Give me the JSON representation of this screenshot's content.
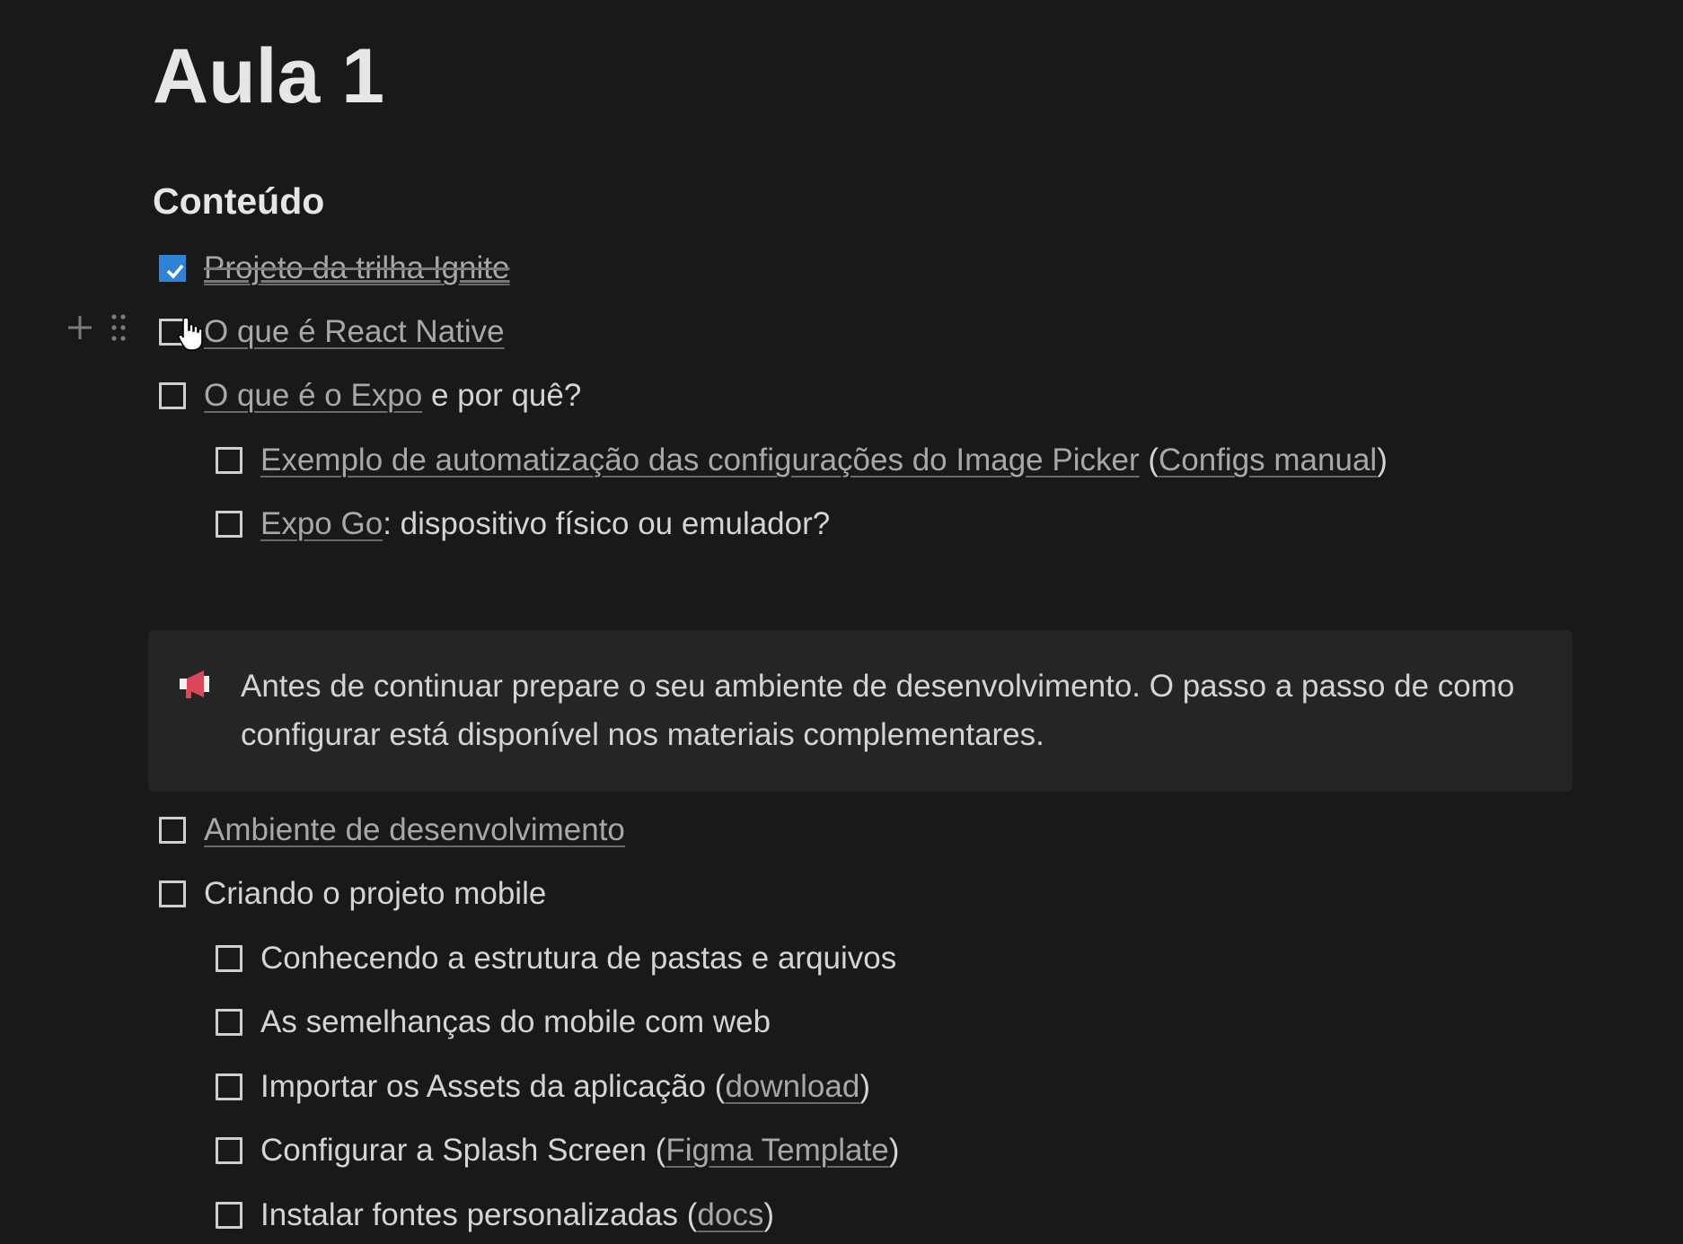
{
  "page": {
    "title": "Aula 1",
    "section_heading": "Conteúdo"
  },
  "todos": [
    {
      "checked": true,
      "indent": 0,
      "parts": [
        {
          "text": "Projeto da trilha Ignite",
          "link": true
        }
      ]
    },
    {
      "checked": false,
      "indent": 0,
      "parts": [
        {
          "text": "O que é React Native",
          "link": true
        }
      ]
    },
    {
      "checked": false,
      "indent": 0,
      "parts": [
        {
          "text": "O que é o Expo",
          "link": true
        },
        {
          "text": " e por quê?",
          "link": false
        }
      ]
    },
    {
      "checked": false,
      "indent": 1,
      "parts": [
        {
          "text": "Exemplo de automatização das configurações do Image Picker",
          "link": true
        },
        {
          "text": " (",
          "link": false
        },
        {
          "text": "Configs manual",
          "link": true
        },
        {
          "text": ")",
          "link": false
        }
      ]
    },
    {
      "checked": false,
      "indent": 1,
      "parts": [
        {
          "text": "Expo Go",
          "link": true
        },
        {
          "text": ": dispositivo físico ou emulador?",
          "link": false
        }
      ]
    }
  ],
  "callout": {
    "icon": "megaphone-icon",
    "text": "Antes de continuar prepare o seu ambiente de desenvolvimento. O passo a passo de como configurar está disponível nos materiais complementares."
  },
  "todos_after": [
    {
      "checked": false,
      "indent": 0,
      "parts": [
        {
          "text": "Ambiente de desenvolvimento",
          "link": true
        }
      ]
    },
    {
      "checked": false,
      "indent": 0,
      "parts": [
        {
          "text": "Criando o projeto mobile",
          "link": false
        }
      ]
    },
    {
      "checked": false,
      "indent": 1,
      "parts": [
        {
          "text": "Conhecendo a estrutura de pastas e arquivos",
          "link": false
        }
      ]
    },
    {
      "checked": false,
      "indent": 1,
      "parts": [
        {
          "text": "As semelhanças do mobile com web",
          "link": false
        }
      ]
    },
    {
      "checked": false,
      "indent": 1,
      "parts": [
        {
          "text": "Importar os Assets da aplicação (",
          "link": false
        },
        {
          "text": "download",
          "link": true
        },
        {
          "text": ")",
          "link": false
        }
      ]
    },
    {
      "checked": false,
      "indent": 1,
      "parts": [
        {
          "text": "Configurar a Splash Screen (",
          "link": false
        },
        {
          "text": "Figma Template",
          "link": true
        },
        {
          "text": ")",
          "link": false
        }
      ]
    },
    {
      "checked": false,
      "indent": 1,
      "parts": [
        {
          "text": "Instalar fontes personalizadas (",
          "link": false
        },
        {
          "text": "docs",
          "link": true
        },
        {
          "text": ")",
          "link": false
        }
      ]
    }
  ],
  "hover_tools": [
    "plus-icon",
    "drag-handle-icon"
  ],
  "colors": {
    "background": "#191919",
    "text": "#d4d4d4",
    "link": "#a8a8a8",
    "checkbox_checked": "#2f83d6",
    "callout_bg": "#252525",
    "megaphone": "#d9475a"
  }
}
